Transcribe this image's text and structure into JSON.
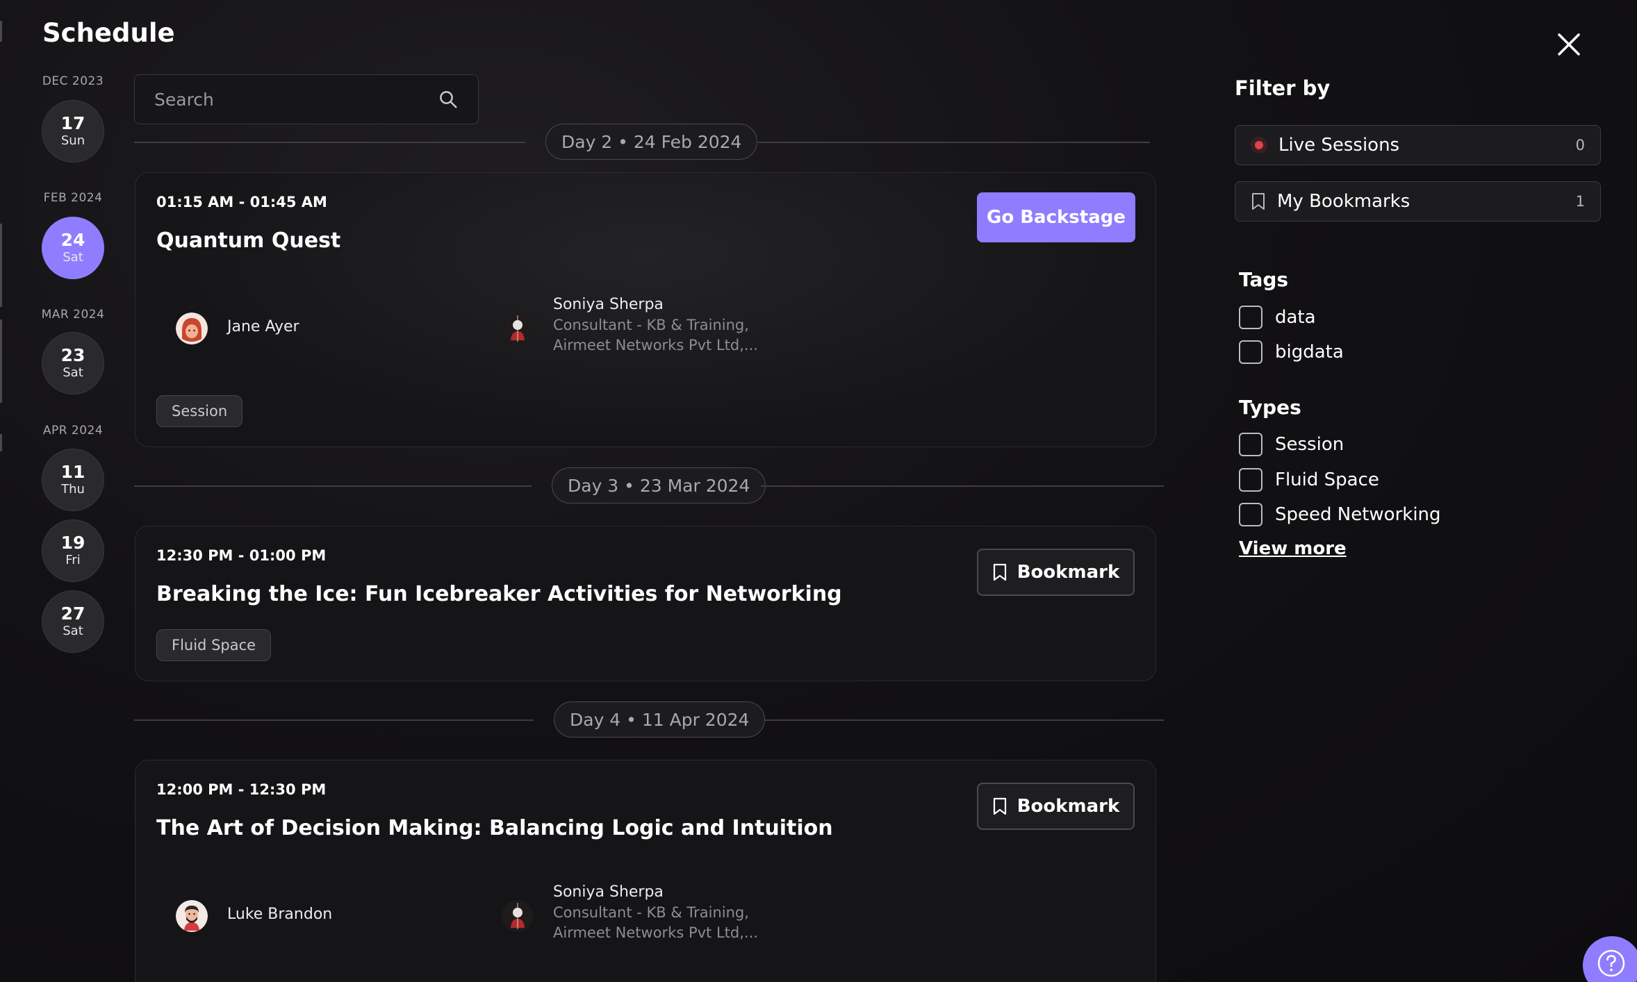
{
  "header": {
    "title": "Schedule"
  },
  "date_rail": {
    "months": [
      "DEC 2023",
      "FEB 2024",
      "MAR 2024",
      "APR 2024"
    ],
    "days": [
      {
        "num": "17",
        "dow": "Sun"
      },
      {
        "num": "24",
        "dow": "Sat"
      },
      {
        "num": "23",
        "dow": "Sat"
      },
      {
        "num": "11",
        "dow": "Thu"
      },
      {
        "num": "19",
        "dow": "Fri"
      },
      {
        "num": "27",
        "dow": "Sat"
      }
    ]
  },
  "search": {
    "placeholder": "Search",
    "value": ""
  },
  "dividers": [
    "Day 2 • 24 Feb 2024",
    "Day 3 • 23 Mar 2024",
    "Day 4 • 11 Apr 2024"
  ],
  "sessions": [
    {
      "time": "01:15 AM - 01:45 AM",
      "title": "Quantum Quest",
      "action": "Go Backstage",
      "speakers": [
        {
          "name": "Jane Ayer"
        },
        {
          "name": "Soniya Sherpa",
          "role_line1": "Consultant - KB & Training,",
          "role_line2": "Airmeet Networks Pvt Ltd,..."
        }
      ],
      "tag": "Session"
    },
    {
      "time": "12:30 PM - 01:00 PM",
      "title": "Breaking the Ice: Fun Icebreaker Activities for Networking",
      "action": "Bookmark",
      "tag": "Fluid Space"
    },
    {
      "time": "12:00 PM - 12:30 PM",
      "title": "The Art of Decision Making: Balancing Logic and Intuition",
      "action": "Bookmark",
      "speakers": [
        {
          "name": "Luke Brandon"
        },
        {
          "name": "Soniya Sherpa",
          "role_line1": "Consultant - KB & Training,",
          "role_line2": "Airmeet Networks Pvt Ltd,..."
        }
      ]
    }
  ],
  "filters": {
    "title": "Filter by",
    "live": {
      "label": "Live Sessions",
      "count": "0",
      "color": "#e0414a"
    },
    "bookmarks": {
      "label": "My Bookmarks",
      "count": "1"
    },
    "tags_title": "Tags",
    "tags": [
      "data",
      "bigdata"
    ],
    "types_title": "Types",
    "types": [
      "Session",
      "Fluid Space",
      "Speed Networking"
    ],
    "view_more": "View more"
  },
  "colors": {
    "accent": "#8f7dff",
    "background": "#0f0e10",
    "live": "#e0414a"
  }
}
